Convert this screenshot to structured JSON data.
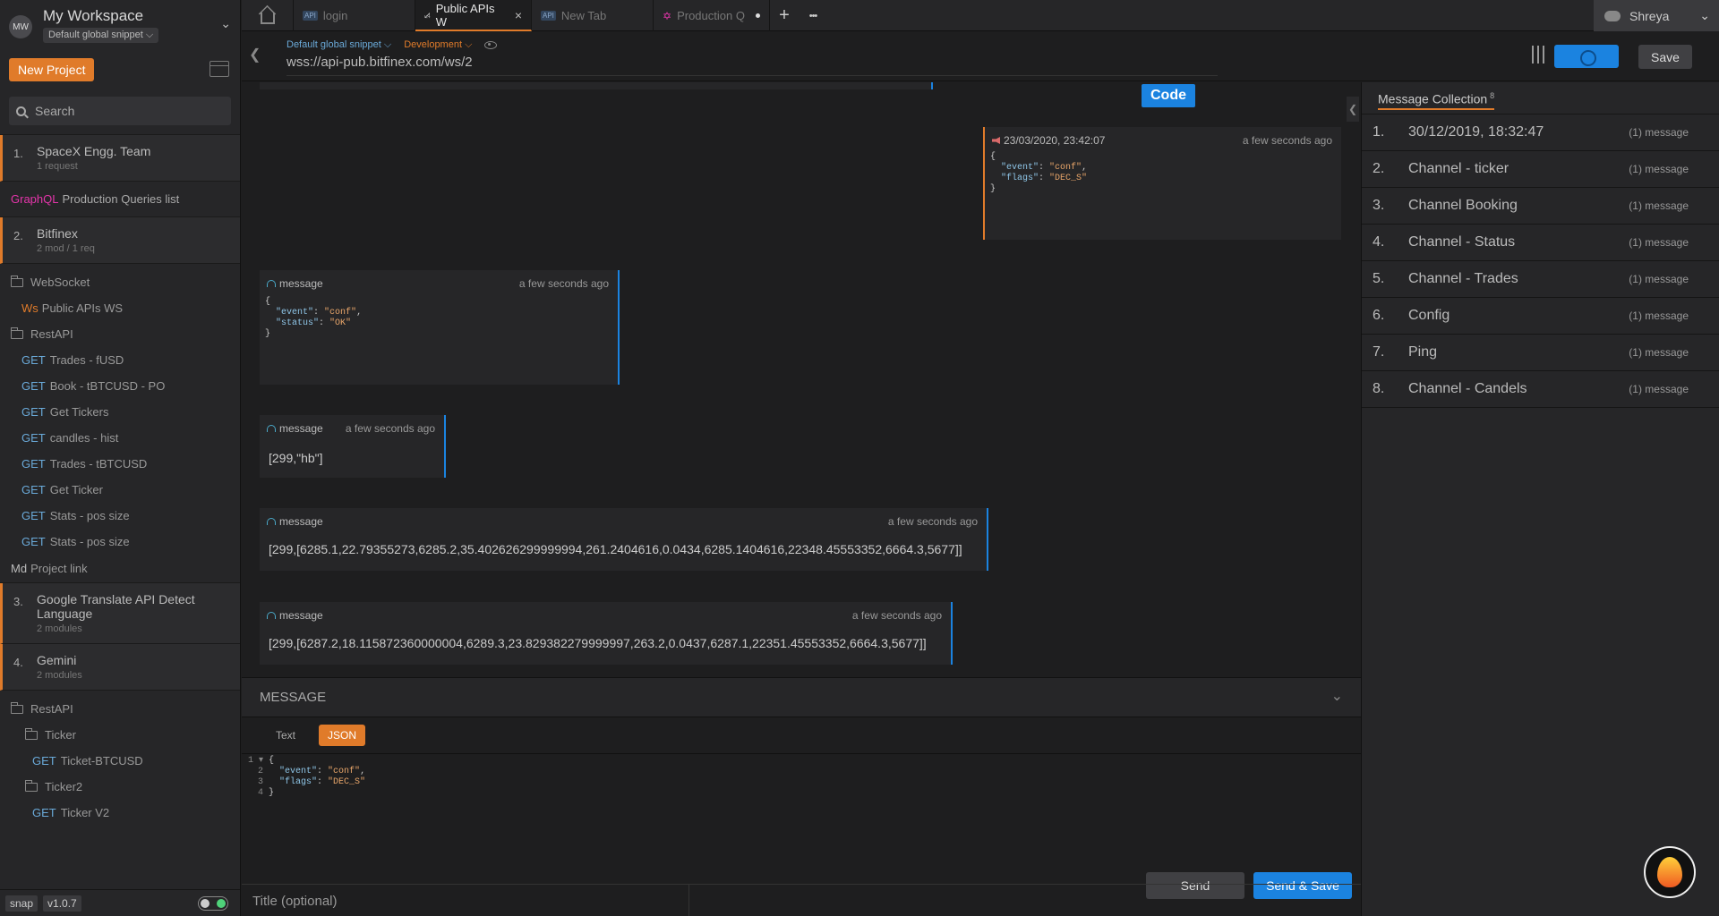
{
  "workspace": {
    "avatar": "MW",
    "name": "My Workspace",
    "snippet": "Default global snippet ⌵",
    "new_project": "New Project",
    "search_placeholder": "Search"
  },
  "sidebar": {
    "projects": [
      {
        "num": "1.",
        "name": "SpaceX Engg. Team",
        "sub": "1 request"
      },
      {
        "num": "2.",
        "name": "Bitfinex",
        "sub": "2 mod / 1 req"
      },
      {
        "num": "3.",
        "name": "Google Translate API Detect Language",
        "sub": "2 modules"
      },
      {
        "num": "4.",
        "name": "Gemini",
        "sub": "2 modules"
      }
    ],
    "graphql_item": {
      "method": "GraphQL",
      "label": "Production Queries list"
    },
    "bitfinex_tree": [
      {
        "type": "folder",
        "label": "WebSocket"
      },
      {
        "type": "ws",
        "method": "Ws",
        "label": "Public APIs WS"
      },
      {
        "type": "folder",
        "label": "RestAPI"
      },
      {
        "type": "get",
        "method": "GET",
        "label": "Trades - fUSD"
      },
      {
        "type": "get",
        "method": "GET",
        "label": "Book - tBTCUSD - PO"
      },
      {
        "type": "get",
        "method": "GET",
        "label": "Get Tickers"
      },
      {
        "type": "get",
        "method": "GET",
        "label": "candles - hist"
      },
      {
        "type": "get",
        "method": "GET",
        "label": "Trades - tBTCUSD"
      },
      {
        "type": "get",
        "method": "GET",
        "label": "Get Ticker"
      },
      {
        "type": "get",
        "method": "GET",
        "label": "Stats - pos size"
      },
      {
        "type": "get",
        "method": "GET",
        "label": "Stats - pos size"
      }
    ],
    "md_item": {
      "method": "Md",
      "label": "Project link"
    },
    "gemini_tree": [
      {
        "label": "RestAPI"
      },
      {
        "label": "Ticker"
      },
      {
        "method": "GET",
        "label": "Ticket-BTCUSD"
      },
      {
        "label": "Ticker2"
      },
      {
        "method": "GET",
        "label": "Ticker V2"
      }
    ],
    "footer": {
      "app": "snap",
      "version": "v1.0.7"
    }
  },
  "tabs": [
    {
      "badge": "API",
      "label": "login"
    },
    {
      "label": "Public APIs W",
      "close": "×"
    },
    {
      "badge": "API",
      "label": "New Tab"
    },
    {
      "label": "Production Q"
    }
  ],
  "tabbar": {
    "plus": "+",
    "more": "•••",
    "user": "Shreya"
  },
  "request": {
    "snippet": "Default global snippet ⌵",
    "environment": "Development ⌵",
    "url": "wss://api-pub.bitfinex.com/ws/2",
    "save": "Save"
  },
  "messages": {
    "code_button": "Code",
    "sent": {
      "timestamp": "23/03/2020, 23:42:07",
      "time": "a few seconds ago"
    },
    "received": [
      {
        "label": "message",
        "time": "a few seconds ago"
      },
      {
        "label": "message",
        "time": "a few seconds ago",
        "body": "[299,\"hb\"]"
      },
      {
        "label": "message",
        "time": "a few seconds ago",
        "body": "[299,[6285.1,22.79355273,6285.2,35.402626299999994,261.2404616,0.0434,6285.1404616,22348.45553352,6664.3,5677]]"
      },
      {
        "label": "message",
        "time": "a few seconds ago",
        "body": "[299,[6287.2,18.115872360000004,6289.3,23.829382279999997,263.2,0.0437,6287.1,22351.45553352,6664.3,5677]]"
      }
    ]
  },
  "editor": {
    "header": "MESSAGE",
    "format_text": "Text",
    "format_json": "JSON",
    "send": "Send",
    "send_save": "Send & Save",
    "title_placeholder": "Title (optional)"
  },
  "collection": {
    "title": "Message Collection",
    "count": "8",
    "items": [
      {
        "num": "1.",
        "label": "30/12/2019, 18:32:47",
        "count": "(1) message"
      },
      {
        "num": "2.",
        "label": "Channel - ticker",
        "count": "(1) message"
      },
      {
        "num": "3.",
        "label": "Channel Booking",
        "count": "(1) message"
      },
      {
        "num": "4.",
        "label": "Channel - Status",
        "count": "(1) message"
      },
      {
        "num": "5.",
        "label": "Channel - Trades",
        "count": "(1) message"
      },
      {
        "num": "6.",
        "label": "Config",
        "count": "(1) message"
      },
      {
        "num": "7.",
        "label": "Ping",
        "count": "(1) message"
      },
      {
        "num": "8.",
        "label": "Channel - Candels",
        "count": "(1) message"
      }
    ]
  },
  "colors": {
    "accent": "#e07b2a",
    "primary": "#1b83e0",
    "background": "#1e1e1f"
  }
}
